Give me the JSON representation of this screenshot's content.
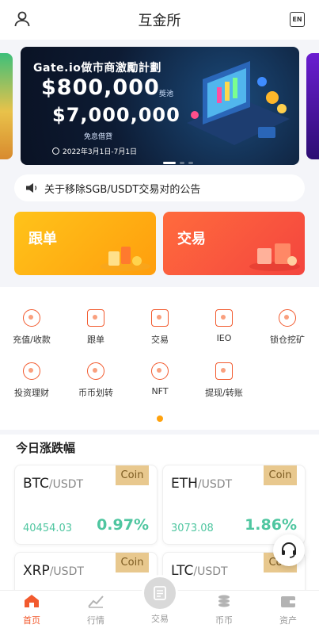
{
  "header": {
    "title": "互金所",
    "lang": "EN"
  },
  "banner": {
    "title": "Gate.io做市商激勵計劃",
    "amount1": "$800,000",
    "pool": "獎池",
    "amount2": "$7,000,000",
    "sub": "免息借貸",
    "date": "2022年3月1日-7月1日"
  },
  "notice": {
    "text": "关于移除SGB/USDT交易对的公告"
  },
  "actions": {
    "follow": "跟单",
    "trade": "交易"
  },
  "grid": [
    {
      "label": "充值/收款",
      "icon": "deposit-icon"
    },
    {
      "label": "跟单",
      "icon": "copy-order-icon"
    },
    {
      "label": "交易",
      "icon": "trade-chart-icon"
    },
    {
      "label": "IEO",
      "icon": "ieo-icon"
    },
    {
      "label": "锁仓挖矿",
      "icon": "lock-mining-icon"
    },
    {
      "label": "投资理财",
      "icon": "invest-icon"
    },
    {
      "label": "币币划转",
      "icon": "transfer-icon"
    },
    {
      "label": "NFT",
      "icon": "nft-icon"
    },
    {
      "label": "提现/转账",
      "icon": "withdraw-icon"
    }
  ],
  "market": {
    "title": "今日涨跌幅",
    "cards": [
      {
        "base": "BTC",
        "quote": "/USDT",
        "tag": "Coin",
        "price": "40454.03",
        "change": "0.97%"
      },
      {
        "base": "ETH",
        "quote": "/USDT",
        "tag": "Coin",
        "price": "3073.08",
        "change": "1.86%"
      },
      {
        "base": "XRP",
        "quote": "/USDT",
        "tag": "Coin",
        "price": "",
        "change": ""
      },
      {
        "base": "LTC",
        "quote": "/USDT",
        "tag": "Coin",
        "price": "",
        "change": ""
      }
    ]
  },
  "tabs": [
    {
      "label": "首页",
      "icon": "home-icon"
    },
    {
      "label": "行情",
      "icon": "market-chart-icon"
    },
    {
      "label": "交易",
      "icon": "trade-icon"
    },
    {
      "label": "币币",
      "icon": "coins-icon"
    },
    {
      "label": "资产",
      "icon": "wallet-icon"
    }
  ],
  "colors": {
    "accent": "#f25a2e",
    "up": "#4fc6a0",
    "gold": "#e8c88e"
  }
}
